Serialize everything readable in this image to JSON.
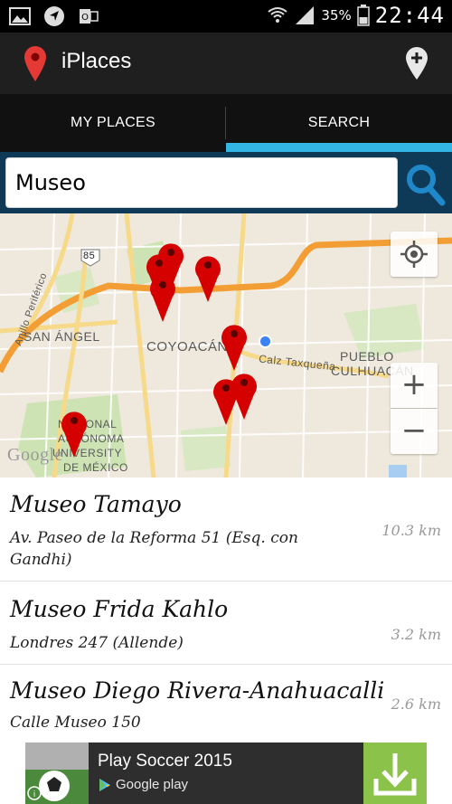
{
  "status_bar": {
    "battery": "35%",
    "time": "22:44",
    "icons": [
      "gallery-icon",
      "navigation-icon",
      "outlook-icon",
      "wifi-icon",
      "signal-icon",
      "battery-icon"
    ]
  },
  "app": {
    "title": "iPlaces",
    "logo_icon": "map-pin-icon",
    "add_place_icon": "add-place-pin-icon"
  },
  "tabs": [
    {
      "label": "MY PLACES",
      "selected": false
    },
    {
      "label": "SEARCH",
      "selected": true
    }
  ],
  "search": {
    "value": "Museo",
    "icon": "search-icon"
  },
  "map": {
    "labels": {
      "route_shield": "85",
      "san_angel": "SAN ÁNGEL",
      "coyoacan": "COYOACÁN",
      "pueblo": "PUEBLO",
      "culhuacan": "CULHUACÁN",
      "calz_taxquena": "Calz Taxqueña",
      "anillo": "Anillo Periférico",
      "unam_line1": "NACIONAL",
      "unam_line2": "AUTÓNOMA",
      "unam_line3": "UNIVERSITY",
      "unam_line4": "DE MÉXICO",
      "google": "Google"
    },
    "controls": {
      "locate_icon": "my-location-icon",
      "zoom_in": "+",
      "zoom_out": "−"
    },
    "accent_pin_color": "#d50000",
    "my_location_color": "#3b82f6"
  },
  "results": [
    {
      "name": "Museo Tamayo",
      "address": "Av. Paseo de la Reforma 51 (Esq. con Gandhi)",
      "distance": "10.3 km"
    },
    {
      "name": "Museo Frida Kahlo",
      "address": "Londres 247 (Allende)",
      "distance": "3.2 km"
    },
    {
      "name": "Museo Diego Rivera-Anahuacalli",
      "address": "Calle Museo 150",
      "distance": "2.6 km"
    }
  ],
  "ad": {
    "title": "Play Soccer 2015",
    "store": "Google play",
    "download_icon": "download-icon",
    "accent": "#8bc34a"
  },
  "colors": {
    "tab_indicator": "#33b5e5",
    "search_row": "#0e3a57",
    "search_icon": "#1e88c8"
  }
}
